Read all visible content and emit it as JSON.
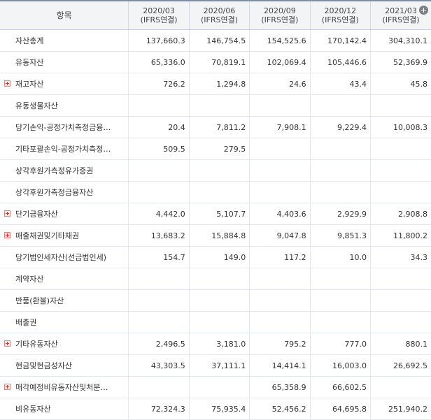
{
  "header": {
    "item_label": "항목",
    "periods": [
      {
        "date": "2020/03",
        "basis": "(IFRS연결)"
      },
      {
        "date": "2020/06",
        "basis": "(IFRS연결)"
      },
      {
        "date": "2020/09",
        "basis": "(IFRS연결)"
      },
      {
        "date": "2020/12",
        "basis": "(IFRS연결)"
      },
      {
        "date": "2021/03",
        "basis": "(IFRS연결)"
      }
    ],
    "add_icon": "plus-circle-icon"
  },
  "rows": [
    {
      "label": "자산총계",
      "toggle": false,
      "values": [
        "137,660.3",
        "146,754.5",
        "154,525.6",
        "170,142.4",
        "304,310.1"
      ]
    },
    {
      "label": "유동자산",
      "toggle": false,
      "values": [
        "65,336.0",
        "70,819.1",
        "102,069.4",
        "105,446.6",
        "52,369.9"
      ]
    },
    {
      "label": "재고자산",
      "toggle": true,
      "values": [
        "726.2",
        "1,294.8",
        "24.6",
        "43.4",
        "45.8"
      ]
    },
    {
      "label": "유동생물자산",
      "toggle": false,
      "values": [
        "",
        "",
        "",
        "",
        ""
      ]
    },
    {
      "label": "당기손익-공정가치측정금융…",
      "toggle": false,
      "values": [
        "20.4",
        "7,811.2",
        "7,908.1",
        "9,229.4",
        "10,008.3"
      ]
    },
    {
      "label": "기타포괄손익-공정가치측정…",
      "toggle": false,
      "values": [
        "509.5",
        "279.5",
        "",
        "",
        ""
      ]
    },
    {
      "label": "상각후원가측정유가증권",
      "toggle": false,
      "values": [
        "",
        "",
        "",
        "",
        ""
      ]
    },
    {
      "label": "상각후원가측정금융자산",
      "toggle": false,
      "values": [
        "",
        "",
        "",
        "",
        ""
      ]
    },
    {
      "label": "단기금융자산",
      "toggle": true,
      "values": [
        "4,442.0",
        "5,107.7",
        "4,403.6",
        "2,929.9",
        "2,908.8"
      ]
    },
    {
      "label": "매출채권및기타채권",
      "toggle": true,
      "values": [
        "13,683.2",
        "15,884.8",
        "9,047.8",
        "9,851.3",
        "11,800.2"
      ]
    },
    {
      "label": "당기법인세자산(선급법인세)",
      "toggle": false,
      "values": [
        "154.7",
        "149.0",
        "117.2",
        "10.0",
        "34.3"
      ]
    },
    {
      "label": "계약자산",
      "toggle": false,
      "values": [
        "",
        "",
        "",
        "",
        ""
      ]
    },
    {
      "label": "반품(환불)자산",
      "toggle": false,
      "values": [
        "",
        "",
        "",
        "",
        ""
      ]
    },
    {
      "label": "배출권",
      "toggle": false,
      "values": [
        "",
        "",
        "",
        "",
        ""
      ]
    },
    {
      "label": "기타유동자산",
      "toggle": true,
      "values": [
        "2,496.5",
        "3,181.0",
        "795.2",
        "777.0",
        "880.1"
      ]
    },
    {
      "label": "현금및현금성자산",
      "toggle": false,
      "values": [
        "43,303.5",
        "37,111.1",
        "14,414.1",
        "16,003.0",
        "26,692.5"
      ]
    },
    {
      "label": "매각예정비유동자산및처분…",
      "toggle": true,
      "values": [
        "",
        "",
        "65,358.9",
        "66,602.5",
        ""
      ]
    },
    {
      "label": "비유동자산",
      "toggle": false,
      "values": [
        "72,324.3",
        "75,935.4",
        "52,456.2",
        "64,695.8",
        "251,940.2"
      ]
    }
  ]
}
